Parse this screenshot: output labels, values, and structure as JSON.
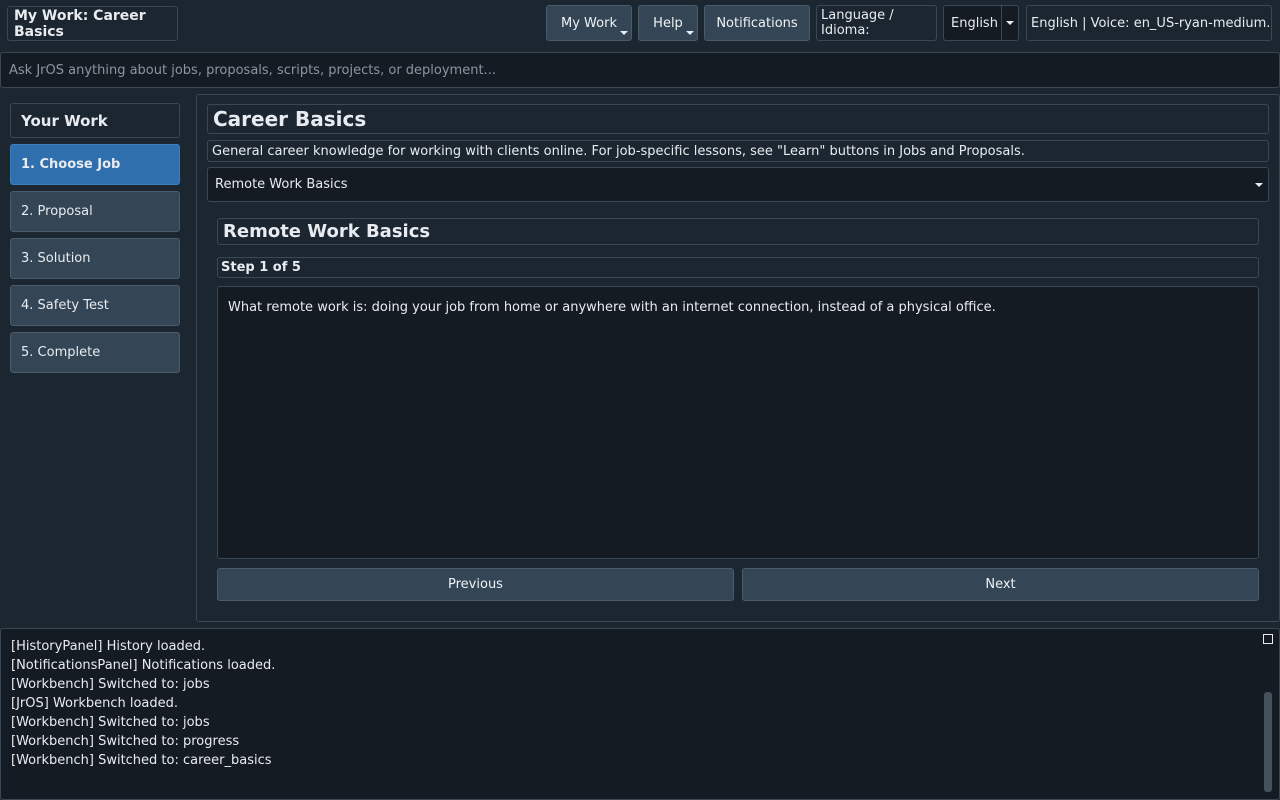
{
  "header": {
    "app_title": "My Work: Career Basics",
    "menu_mywork": "My Work",
    "menu_help": "Help",
    "notifications": "Notifications",
    "language_label": "Language / Idioma:",
    "language_selected": "English",
    "voice_info": "English | Voice: en_US-ryan-medium.onnx"
  },
  "search": {
    "placeholder": "Ask JrOS anything about jobs, proposals, scripts, projects, or deployment...",
    "value": ""
  },
  "sidebar": {
    "title": "Your Work",
    "steps": [
      {
        "label": "1. Choose Job",
        "active": true
      },
      {
        "label": "2. Proposal",
        "active": false
      },
      {
        "label": "3. Solution",
        "active": false
      },
      {
        "label": "4. Safety Test",
        "active": false
      },
      {
        "label": "5. Complete",
        "active": false
      }
    ]
  },
  "main": {
    "title": "Career Basics",
    "description": "General career knowledge for working with clients online. For job-specific lessons, see \"Learn\" buttons in Jobs and Proposals.",
    "topic_selected": "Remote Work Basics",
    "lesson": {
      "title": "Remote Work Basics",
      "step": "Step 1 of 5",
      "body": "What remote work is: doing your job from home or anywhere with an internet connection, instead of a physical office."
    },
    "previous_label": "Previous",
    "next_label": "Next"
  },
  "log": {
    "lines": [
      "[HistoryPanel] History loaded.",
      "[NotificationsPanel] Notifications loaded.",
      "[Workbench] Switched to: jobs",
      "[JrOS] Workbench loaded.",
      "[Workbench] Switched to: jobs",
      "[Workbench] Switched to: progress",
      "[Workbench] Switched to: career_basics"
    ]
  },
  "colors": {
    "background": "#1b2631",
    "button": "#344556",
    "active_step": "#2f6fae",
    "input_bg": "#141b23"
  }
}
